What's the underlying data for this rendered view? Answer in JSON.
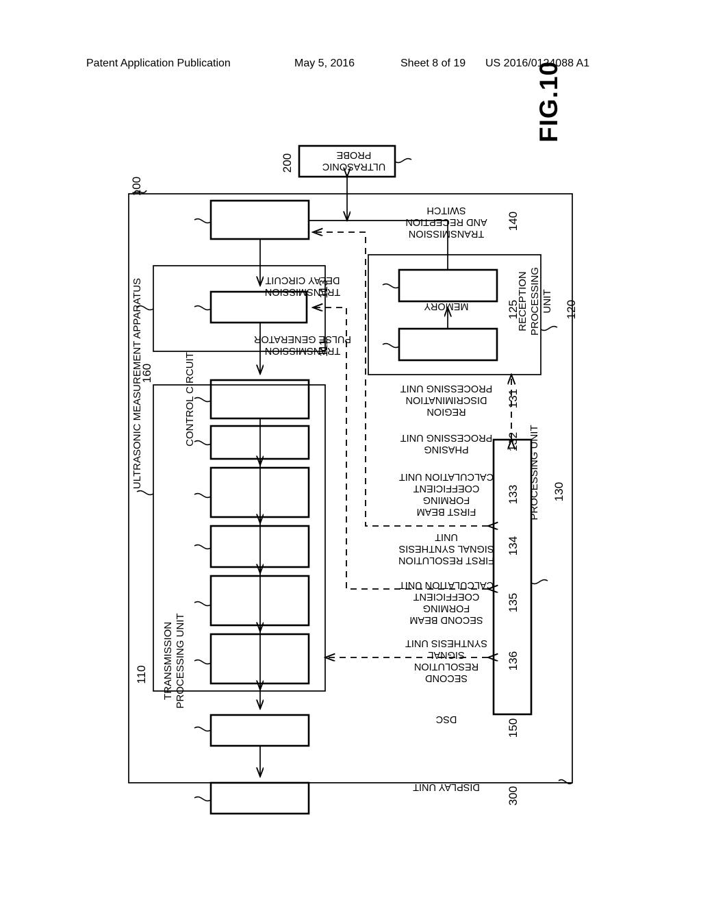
{
  "header": {
    "publication": "Patent Application Publication",
    "date": "May 5, 2016",
    "sheet": "Sheet 8 of 19",
    "docnum": "US 2016/0124088 A1"
  },
  "figure": {
    "label": "FIG.10",
    "orientation_note": "diagram drawn rotated 180 degrees on the page"
  },
  "diagram": {
    "apparatus": {
      "label": "ULTRASONIC MEASUREMENT APPARATUS",
      "ref": "100"
    },
    "blocks": [
      {
        "id": "probe",
        "ref": "200",
        "lines": [
          "ULTRASONIC",
          "PROBE"
        ]
      },
      {
        "id": "switch",
        "ref": "140",
        "lines": [
          "TRANSMISSION",
          "AND RECEPTION",
          "SWITCH"
        ]
      },
      {
        "id": "tx-unit",
        "ref": "110",
        "lines": [
          "TRANSMISSION",
          "PROCESSING UNIT"
        ]
      },
      {
        "id": "pulse-gen",
        "ref": "111",
        "lines": [
          "TRANSMISSION",
          "PULSE GENERATOR"
        ]
      },
      {
        "id": "delay-circuit",
        "ref": "113",
        "lines": [
          "TRANSMISSION",
          "DELAY CIRCUIT"
        ]
      },
      {
        "id": "rx-unit",
        "ref": "120",
        "lines": [
          "RECEPTION",
          "PROCESSING",
          "UNIT"
        ]
      },
      {
        "id": "memory",
        "ref": "125",
        "lines": [
          "MEMORY"
        ]
      },
      {
        "id": "proc-unit",
        "ref": "130",
        "lines": [
          "PROCESSING UNIT"
        ]
      },
      {
        "id": "region-disc",
        "ref": "131",
        "lines": [
          "REGION",
          "DISCRIMINATION",
          "PROCESSING UNIT"
        ]
      },
      {
        "id": "phasing",
        "ref": "132",
        "lines": [
          "PHASING",
          "PROCESSING UNIT"
        ]
      },
      {
        "id": "first-bf",
        "ref": "133",
        "lines": [
          "FIRST BEAM",
          "FORMING",
          "COEFFICIENT",
          "CALCULATION UNIT"
        ]
      },
      {
        "id": "first-res",
        "ref": "134",
        "lines": [
          "FIRST RESOLUTION",
          "SIGNAL SYNTHESIS",
          "UNIT"
        ]
      },
      {
        "id": "second-bf",
        "ref": "135",
        "lines": [
          "SECOND BEAM",
          "FORMING",
          "COEFFICIENT",
          "CALCULATION UNIT"
        ]
      },
      {
        "id": "second-res",
        "ref": "136",
        "lines": [
          "SECOND",
          "RESOLUTION",
          "SIGNAL",
          "SYNTHESIS UNIT"
        ]
      },
      {
        "id": "dsc",
        "ref": "150",
        "lines": [
          "DSC"
        ]
      },
      {
        "id": "control",
        "ref": "160",
        "lines": [
          "CONTROL CIRCUIT"
        ]
      },
      {
        "id": "display",
        "ref": "300",
        "lines": [
          "DISPLAY UNIT"
        ]
      }
    ]
  }
}
